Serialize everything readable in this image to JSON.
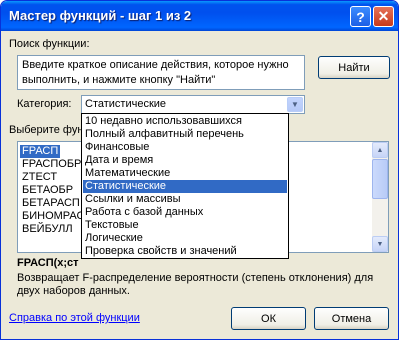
{
  "window": {
    "title": "Мастер функций - шаг 1 из 2",
    "help_glyph": "?",
    "close_glyph": "✕"
  },
  "search": {
    "label": "Поиск функции:",
    "text": "Введите краткое описание действия, которое нужно выполнить, и нажмите кнопку \"Найти\"",
    "find_button": "Найти"
  },
  "category": {
    "label": "Категория:",
    "selected": "Статистические",
    "options": [
      "10 недавно использовавшихся",
      "Полный алфавитный перечень",
      "Финансовые",
      "Дата и время",
      "Математические",
      "Статистические",
      "Ссылки и массивы",
      "Работа с базой данных",
      "Текстовые",
      "Логические",
      "Проверка свойств и значений"
    ],
    "highlighted_index": 5
  },
  "functions": {
    "label": "Выберите фун",
    "items": [
      "FРАСП",
      "FРАСПОБР",
      "ZТЕСТ",
      "БЕТАОБР",
      "БЕТАРАСП",
      "БИНОМРАСП",
      "ВЕЙБУЛЛ"
    ],
    "selected_index": 0,
    "signature": "FРАСП(x;ст",
    "description": "Возвращает F-распределение вероятности (степень отклонения) для двух наборов данных."
  },
  "footer": {
    "help_link": "Справка по этой функции",
    "ok_button": "ОК",
    "cancel_button": "Отмена"
  },
  "colors": {
    "titlebar": "#0054e3",
    "selection": "#316ac5",
    "dialog_bg": "#ece9d8",
    "link": "#0000ff"
  }
}
